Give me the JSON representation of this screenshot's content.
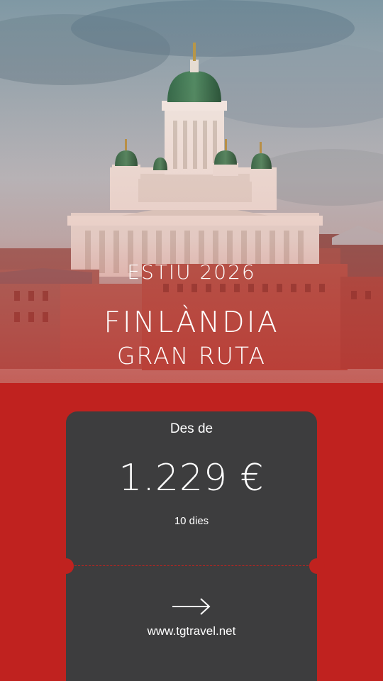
{
  "hero": {
    "season": "ESTIU 2026",
    "destination": "FINLÀNDIA",
    "route": "GRAN RUTA"
  },
  "offer": {
    "price_label": "Des de",
    "price": "1.229 €",
    "duration": "10 dies",
    "cta_icon": "arrow-right-icon",
    "url": "www.tgtravel.net"
  },
  "colors": {
    "brand_red": "#c0221f",
    "card_dark": "#3d3d3e",
    "text": "#ffffff"
  }
}
